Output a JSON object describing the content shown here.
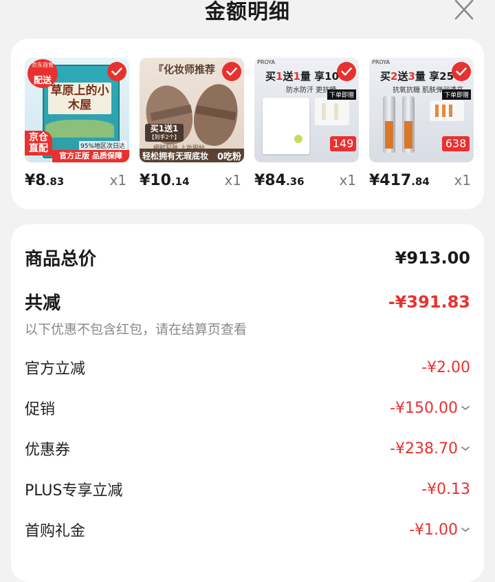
{
  "header": {
    "title": "金额明细"
  },
  "products": [
    {
      "badge_top": "京东自营",
      "badge_mid": "配送",
      "book_title": "草原上的小木屋",
      "corner_badge": "京仓直配",
      "promo_small": "95%地区次日达",
      "promo_bar": "官方正版 品质保障",
      "price_int": "¥8",
      "price_dec": ".83",
      "qty": "x1"
    },
    {
      "headline": "『化妆师推荐",
      "promo": "买1送1",
      "promo_sub": "【到手2个】",
      "sub_line": "细腻贴肤  上妆服帖",
      "bottom": "轻松拥有无瑕底妆",
      "bottom_right": "0吃粉",
      "price_int": "¥10",
      "price_dec": ".14",
      "qty": "x1"
    },
    {
      "brand": "PROYA",
      "headline_a": "买",
      "headline_b": "1",
      "headline_c": "送",
      "headline_d": "1",
      "headline_e": "量 享10",
      "sub": "防水防汗  更抗晒",
      "tag": "下单即赠",
      "deal_price": "149",
      "price_int": "¥84",
      "price_dec": ".36",
      "qty": "x1"
    },
    {
      "brand": "PROYA",
      "headline_a": "买",
      "headline_b": "2",
      "headline_c": "送",
      "headline_d": "3",
      "headline_e": "量 享25",
      "sub": "抗氧抗糖  肌肤弹润透亮",
      "tag": "下单即赠",
      "deal_price": "638",
      "price_int": "¥417",
      "price_dec": ".84",
      "qty": "x1"
    }
  ],
  "summary": {
    "total_label": "商品总价",
    "total_value": "¥913.00",
    "reduce_label": "共减",
    "reduce_value": "-¥391.83",
    "note": "以下优惠不包含红包，请在结算页查看",
    "items": [
      {
        "label": "官方立减",
        "value": "-¥2.00",
        "expandable": false
      },
      {
        "label": "促销",
        "value": "-¥150.00",
        "expandable": true
      },
      {
        "label": "优惠券",
        "value": "-¥238.70",
        "expandable": true
      },
      {
        "label": "PLUS专享立减",
        "value": "-¥0.13",
        "expandable": false
      },
      {
        "label": "首购礼金",
        "value": "-¥1.00",
        "expandable": true
      }
    ]
  },
  "colors": {
    "accent": "#e8312e",
    "text": "#1a1a1a",
    "muted": "#888888"
  }
}
